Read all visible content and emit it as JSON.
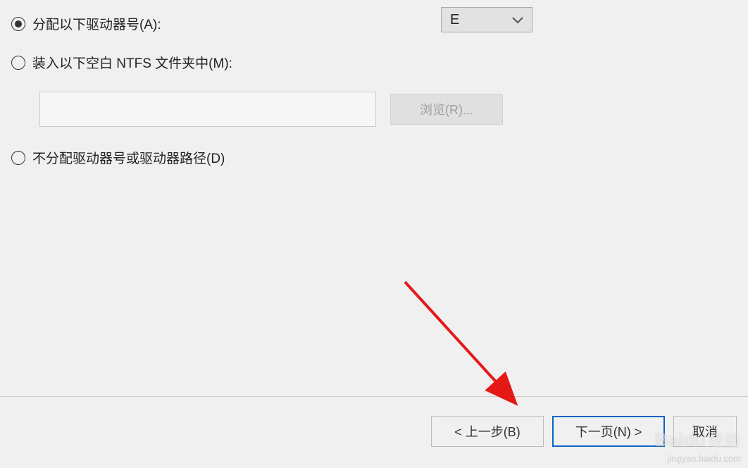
{
  "radios": {
    "assign_letter": "分配以下驱动器号(A):",
    "mount_folder": "装入以下空白 NTFS 文件夹中(M):",
    "no_assign": "不分配驱动器号或驱动器路径(D)"
  },
  "drive_letter": "E",
  "browse_label": "浏览(R)...",
  "buttons": {
    "back": "< 上一步(B)",
    "next": "下一页(N) >",
    "cancel": "取消"
  },
  "watermark_url": "jingyan.baidu.com",
  "watermark_brand": "Baidu",
  "watermark_brand_cn": "经验"
}
